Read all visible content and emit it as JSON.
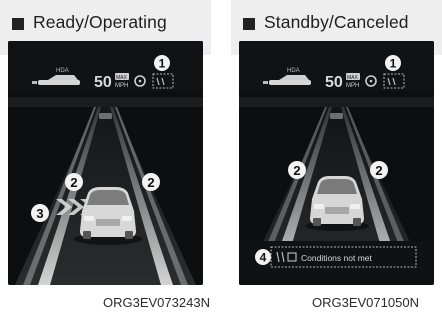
{
  "colors": {
    "screen_bg": "#0d0e0f",
    "title_bg": "#eeeeee",
    "lane_left": "#a9a9a9",
    "callout": "#f2f2f2"
  },
  "panels": [
    {
      "title": "Ready/Operating",
      "hud": {
        "hda_label": "HDA",
        "speed": "50",
        "unit_top": "MAX",
        "unit_bottom": "MPH"
      },
      "callouts": [
        "1",
        "2",
        "2",
        "3"
      ],
      "icons": [
        "car-front-icon",
        "steering-wheel-icon",
        "hands-on-wheel-icon",
        "lane-arrow-icon"
      ],
      "caption": "ORG3EV073243N"
    },
    {
      "title": "Standby/Canceled",
      "hud": {
        "hda_label": "HDA",
        "speed": "50",
        "unit_top": "MAX",
        "unit_bottom": "MPH"
      },
      "callouts": [
        "1",
        "2",
        "2",
        "4"
      ],
      "icons": [
        "car-front-icon",
        "steering-wheel-icon",
        "hands-on-wheel-icon"
      ],
      "message": "Conditions not met",
      "caption": "ORG3EV071050N"
    }
  ]
}
